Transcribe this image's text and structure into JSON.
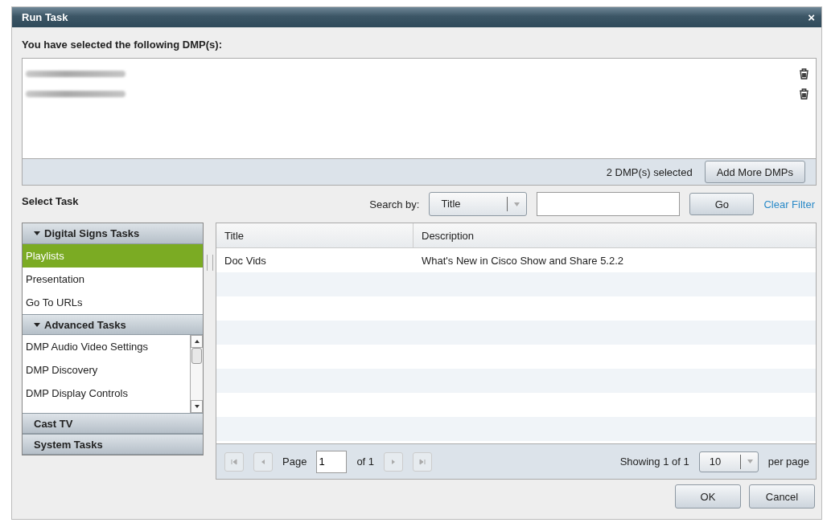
{
  "window": {
    "title": "Run Task",
    "close": "×"
  },
  "selection": {
    "heading": "You have selected the following DMP(s):",
    "dmps": [
      {
        "kind": "blurred"
      },
      {
        "kind": "blurred"
      }
    ],
    "summary": "2 DMP(s) selected",
    "add_button": "Add More DMPs"
  },
  "select_task": {
    "label": "Select Task"
  },
  "search": {
    "label": "Search by:",
    "field": "Title",
    "go": "Go",
    "clear": "Clear Filter"
  },
  "sections": [
    {
      "title": "Digital Signs Tasks",
      "expanded": true,
      "scrollable": false,
      "items": [
        {
          "label": "Playlists",
          "selected": true
        },
        {
          "label": "Presentation",
          "selected": false
        },
        {
          "label": "Go To URLs",
          "selected": false
        }
      ]
    },
    {
      "title": "Advanced Tasks",
      "expanded": true,
      "scrollable": true,
      "items": [
        {
          "label": "DMP Audio Video Settings",
          "selected": false
        },
        {
          "label": "DMP Discovery",
          "selected": false
        },
        {
          "label": "DMP Display Controls",
          "selected": false
        }
      ]
    },
    {
      "title": "Cast TV",
      "expanded": false
    },
    {
      "title": "System Tasks",
      "expanded": false
    }
  ],
  "table": {
    "columns": [
      "Title",
      "Description"
    ],
    "rows": [
      [
        "Doc Vids",
        "What's New in Cisco Show and Share 5.2.2"
      ]
    ]
  },
  "pager": {
    "page_label": "Page",
    "page": "1",
    "of": "of 1",
    "showing": "Showing 1 of 1",
    "per_page_value": "10",
    "per_page": "per page"
  },
  "buttons": [
    "OK",
    "Cancel"
  ]
}
